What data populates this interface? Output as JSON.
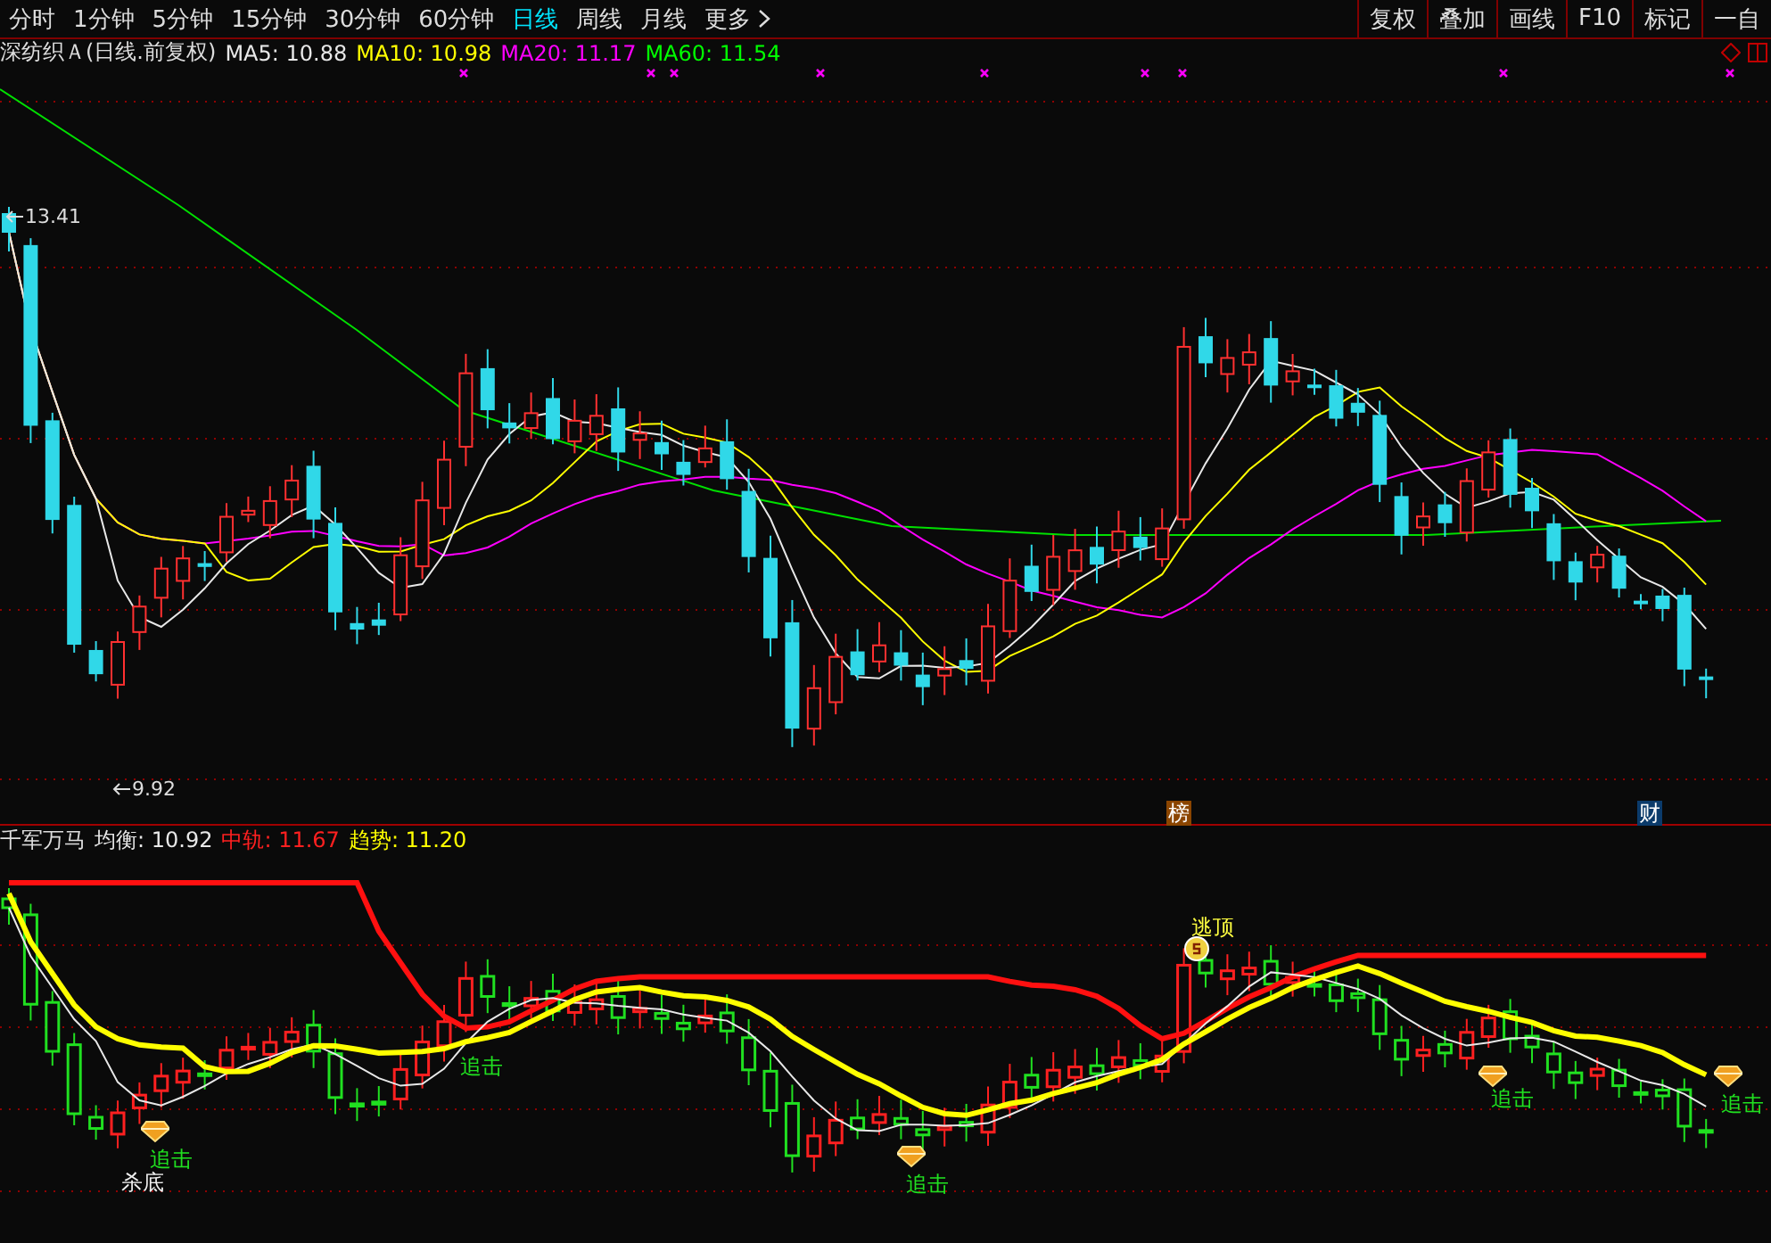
{
  "toolbar": {
    "periods": [
      {
        "label": "分时",
        "selected": false
      },
      {
        "label": "1分钟",
        "selected": false
      },
      {
        "label": "5分钟",
        "selected": false
      },
      {
        "label": "15分钟",
        "selected": false
      },
      {
        "label": "30分钟",
        "selected": false
      },
      {
        "label": "60分钟",
        "selected": false
      },
      {
        "label": "日线",
        "selected": true
      },
      {
        "label": "周线",
        "selected": false
      },
      {
        "label": "月线",
        "selected": false
      }
    ],
    "more": "更多",
    "buttons": [
      "复权",
      "叠加",
      "画线",
      "F10",
      "标记",
      "一自"
    ]
  },
  "legend": {
    "title": "深纺织Ａ(日线.前复权)",
    "items": [
      {
        "label": "MA5: 10.88",
        "color": "#e8e8e8"
      },
      {
        "label": "MA10: 10.98",
        "color": "#ffff00"
      },
      {
        "label": "MA20: 11.17",
        "color": "#ff00ff"
      },
      {
        "label": "MA60: 11.54",
        "color": "#00ff00"
      }
    ]
  },
  "main_chart": {
    "high_label": "13.41",
    "low_label": "9.92",
    "badges": [
      {
        "text": "榜",
        "color": "#8b4500"
      },
      {
        "text": "财",
        "color": "#0b3b6b"
      }
    ]
  },
  "indicator": {
    "name": "千军万马",
    "items": [
      {
        "label": "均衡: 10.92",
        "color": "#e8e8e8"
      },
      {
        "label": "中轨: 11.67",
        "color": "#ff2020"
      },
      {
        "label": "趋势: 11.20",
        "color": "#ffff00"
      }
    ],
    "signals": [
      {
        "kind": "buy",
        "text": "追击"
      },
      {
        "kind": "bottom",
        "text": "杀底"
      },
      {
        "kind": "buy",
        "text": "追击"
      },
      {
        "kind": "buy",
        "text": "追击"
      },
      {
        "kind": "top",
        "text": "逃顶"
      },
      {
        "kind": "buy",
        "text": "追击"
      },
      {
        "kind": "buy",
        "text": "追击"
      }
    ]
  }
}
